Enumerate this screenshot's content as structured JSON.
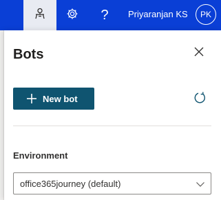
{
  "header": {
    "user_name": "Priyaranjan KS",
    "avatar_initials": "PK",
    "help_glyph": "?",
    "icons": [
      "bot-icon",
      "gear-icon",
      "help-icon"
    ]
  },
  "panel": {
    "title": "Bots",
    "new_bot_label": "New bot",
    "environment_label": "Environment",
    "environment_value": "office365journey (default)"
  },
  "colors": {
    "topbar": "#0a3fd6",
    "primary_button": "#0f5470",
    "active_tab": "#e8ebf2"
  }
}
